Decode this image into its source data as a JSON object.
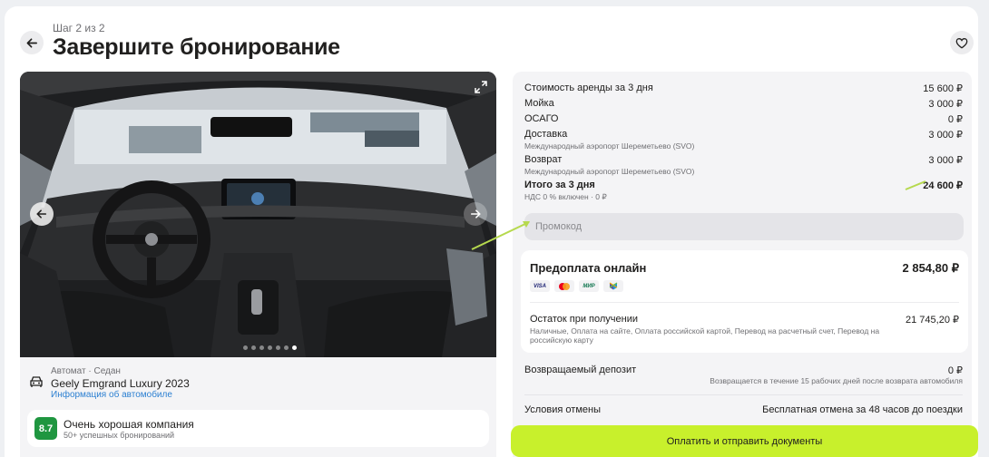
{
  "header": {
    "step": "Шаг 2 из 2",
    "title": "Завершите бронирование"
  },
  "car": {
    "meta": "Автомат · Седан",
    "name": "Geely Emgrand Luxury 2023",
    "info_link": "Информация об автомобиле",
    "gallery_dots": 7,
    "gallery_active_dot": 7
  },
  "company": {
    "rating": "8.7",
    "name": "Очень хорошая компания",
    "subtitle": "50+ успешных бронирований",
    "rating_color": "#1f9640"
  },
  "costs": [
    {
      "label": "Стоимость аренды за 3 дня",
      "value": "15 600 ₽",
      "sub": ""
    },
    {
      "label": "Мойка",
      "value": "3 000 ₽",
      "sub": ""
    },
    {
      "label": "ОСАГО",
      "value": "0 ₽",
      "sub": ""
    },
    {
      "label": "Доставка",
      "value": "3 000 ₽",
      "sub": "Международный аэропорт Шереметьево (SVO)"
    },
    {
      "label": "Возврат",
      "value": "3 000 ₽",
      "sub": "Международный аэропорт Шереметьево (SVO)"
    }
  ],
  "total": {
    "label": "Итого за 3 дня",
    "value": "24 600 ₽",
    "sub": "НДС 0 % включен · 0 ₽"
  },
  "promo": {
    "placeholder": "Промокод",
    "value": ""
  },
  "prepay": {
    "title": "Предоплата онлайн",
    "value": "2 854,80 ₽",
    "methods": [
      "VISA",
      "mastercard",
      "МИР",
      "SBP"
    ],
    "remainder_label": "Остаток при получении",
    "remainder_value": "21 745,20 ₽",
    "remainder_sub": "Наличные, Оплата на сайте, Оплата российской картой, Перевод на расчетный счет, Перевод на российскую карту"
  },
  "deposit": {
    "label": "Возвращаемый депозит",
    "value": "0 ₽",
    "sub": "Возвращается в течение 15 рабочих дней после возврата автомобиля"
  },
  "cancellation": {
    "label": "Условия отмены",
    "value": "Бесплатная отмена за 48 часов до поездки"
  },
  "submit": {
    "label": "Оплатить и отправить документы",
    "color": "#c8f02c"
  }
}
